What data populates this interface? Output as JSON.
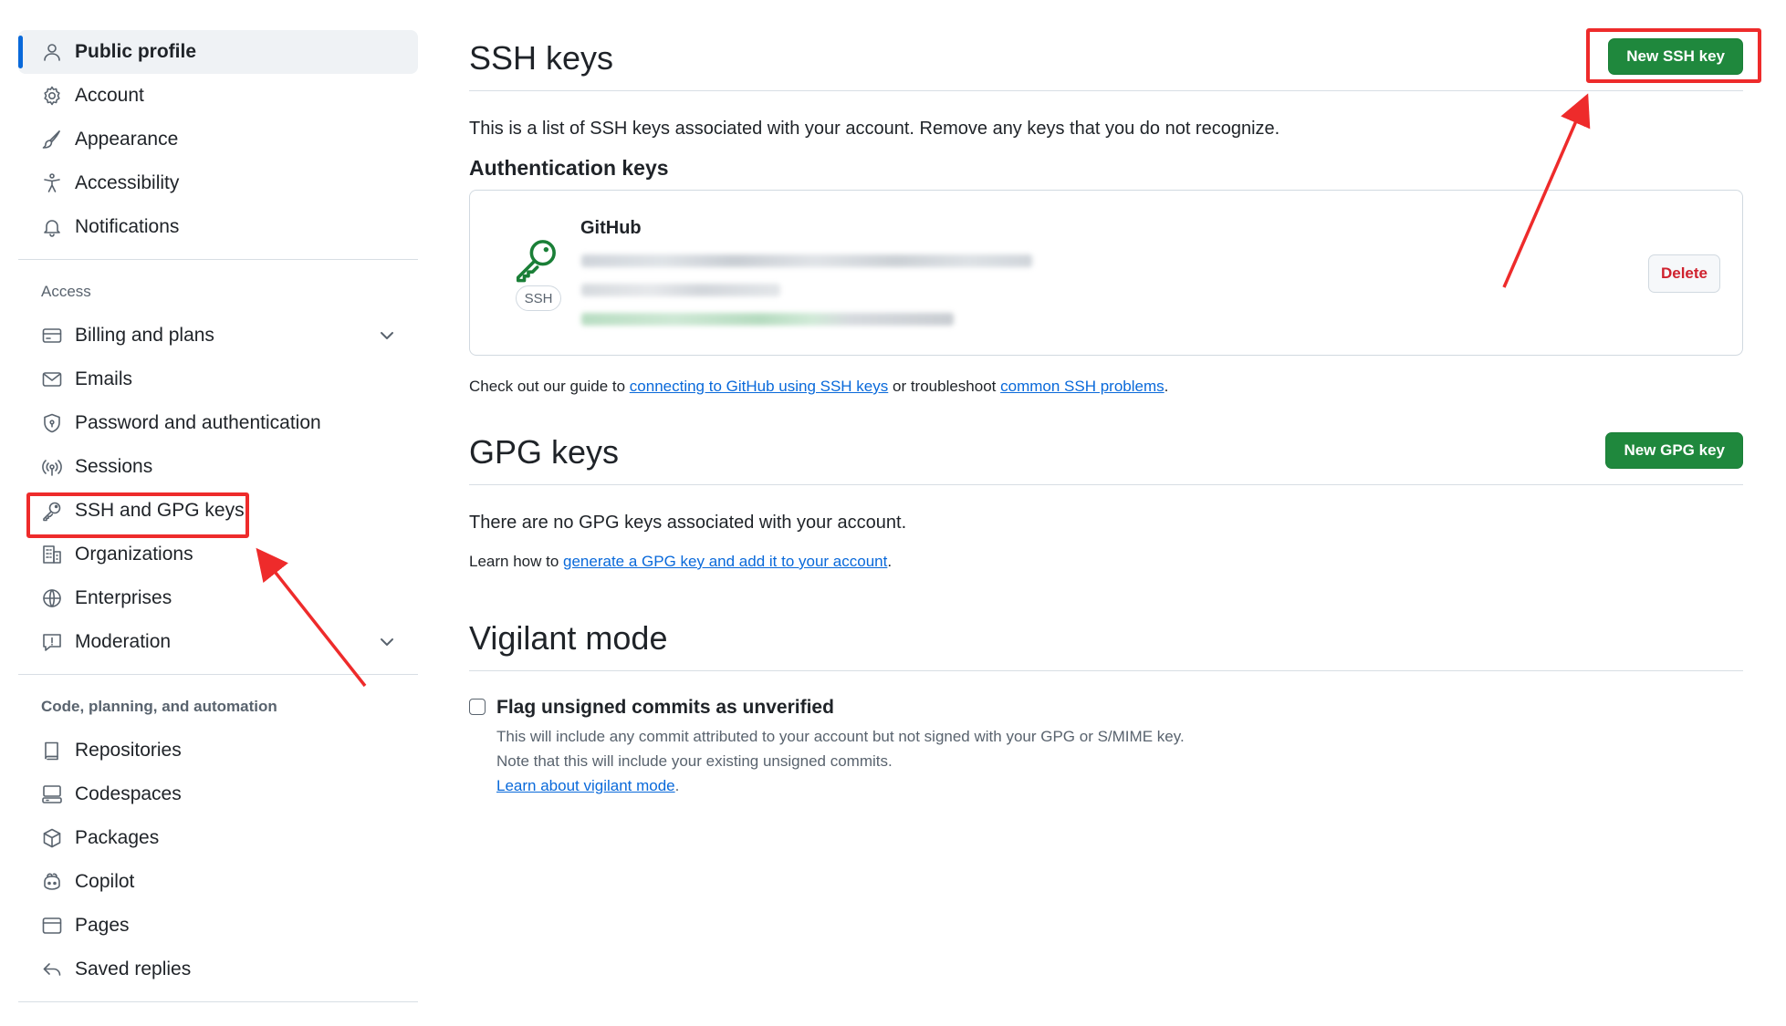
{
  "sidebar": {
    "items_top": [
      {
        "label": "Public profile",
        "icon": "person-icon",
        "active": true
      },
      {
        "label": "Account",
        "icon": "gear-icon"
      },
      {
        "label": "Appearance",
        "icon": "paintbrush-icon"
      },
      {
        "label": "Accessibility",
        "icon": "accessibility-icon"
      },
      {
        "label": "Notifications",
        "icon": "bell-icon"
      }
    ],
    "access_heading": "Access",
    "items_access": [
      {
        "label": "Billing and plans",
        "icon": "credit-card-icon"
      },
      {
        "label": "Emails",
        "icon": "mail-icon"
      },
      {
        "label": "Password and authentication",
        "icon": "shield-lock-icon"
      },
      {
        "label": "Sessions",
        "icon": "broadcast-icon"
      },
      {
        "label": "SSH and GPG keys",
        "icon": "key-icon"
      },
      {
        "label": "Organizations",
        "icon": "organization-icon"
      },
      {
        "label": "Enterprises",
        "icon": "globe-icon"
      },
      {
        "label": "Moderation",
        "icon": "report-icon"
      }
    ],
    "code_heading": "Code, planning, and automation",
    "items_code": [
      {
        "label": "Repositories",
        "icon": "repo-icon"
      },
      {
        "label": "Codespaces",
        "icon": "codespaces-icon"
      },
      {
        "label": "Packages",
        "icon": "package-icon"
      },
      {
        "label": "Copilot",
        "icon": "copilot-icon"
      },
      {
        "label": "Pages",
        "icon": "browser-icon"
      },
      {
        "label": "Saved replies",
        "icon": "reply-icon"
      }
    ]
  },
  "ssh": {
    "title": "SSH keys",
    "new_button": "New SSH key",
    "description": "This is a list of SSH keys associated with your account. Remove any keys that you do not recognize.",
    "auth_heading": "Authentication keys",
    "key": {
      "title": "GitHub",
      "badge": "SSH",
      "delete_label": "Delete"
    },
    "guide_prefix": "Check out our guide to ",
    "guide_link": "connecting to GitHub using SSH keys",
    "guide_middle": " or troubleshoot ",
    "guide_link2": "common SSH problems",
    "guide_suffix": "."
  },
  "gpg": {
    "title": "GPG keys",
    "new_button": "New GPG key",
    "empty_text": "There are no GPG keys associated with your account.",
    "learn_prefix": "Learn how to ",
    "learn_link": "generate a GPG key and add it to your account",
    "learn_suffix": "."
  },
  "vigilant": {
    "title": "Vigilant mode",
    "checkbox_label": "Flag unsigned commits as unverified",
    "checked": false,
    "line1": "This will include any commit attributed to your account but not signed with your GPG or S/MIME key.",
    "line2": "Note that this will include your existing unsigned commits.",
    "learn_link": "Learn about vigilant mode",
    "learn_suffix": "."
  },
  "colors": {
    "accent": "#0969da",
    "green": "#1f883d",
    "danger": "#cf222e",
    "annotation": "#ee2b2b"
  }
}
